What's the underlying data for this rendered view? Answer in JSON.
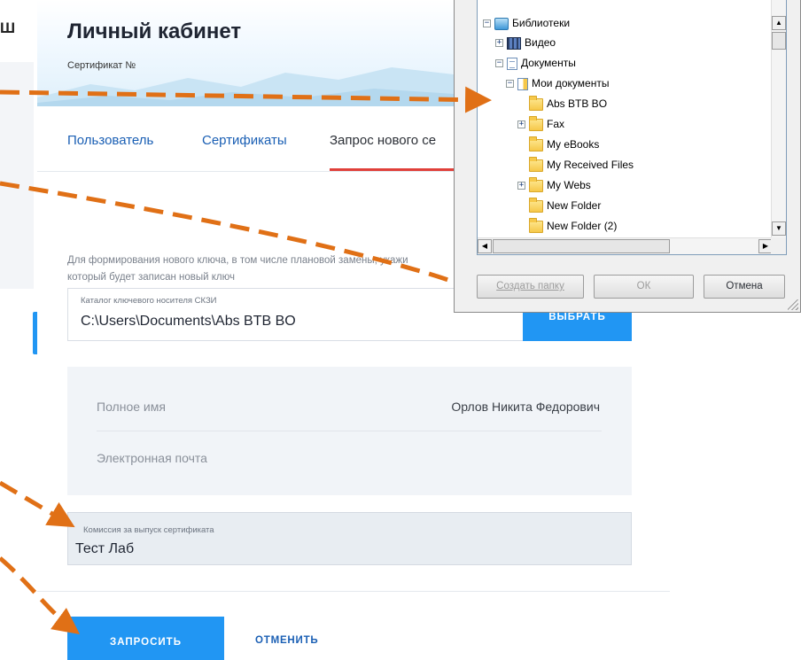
{
  "page": {
    "left_edge_letter": "Ш",
    "title": "Личный кабинет",
    "certificate_label": "Сертификат №"
  },
  "tabs": [
    {
      "label": "Пользователь",
      "active": false
    },
    {
      "label": "Сертификаты",
      "active": false
    },
    {
      "label": "Запрос нового се",
      "active": true
    }
  ],
  "key_form": {
    "description_line1": "Для формирования нового ключа, в том числе плановой замены, укажи",
    "description_line2": "который будет записан новый ключ",
    "field_caption": "Каталог ключевого носителя СКЗИ",
    "field_value": "C:\\Users\\Documents\\Abs BTB BO",
    "choose_button": "ВЫБРАТЬ"
  },
  "info": {
    "full_name_label": "Полное имя",
    "full_name_value": "Орлов Никита Федорович",
    "email_label": "Электронная почта",
    "email_value": ""
  },
  "commission": {
    "caption": "Комиссия за выпуск сертификата",
    "value": "Тест Лаб"
  },
  "actions": {
    "request_button": "ЗАПРОСИТЬ",
    "cancel_link": "ОТМЕНИТЬ"
  },
  "folder_dialog": {
    "tree": [
      {
        "label": "Библиотеки",
        "icon": "library-icon",
        "expander": "−"
      },
      {
        "label": "Видео",
        "icon": "video-icon",
        "expander": "+"
      },
      {
        "label": "Документы",
        "icon": "documents-icon",
        "expander": "−"
      },
      {
        "label": "Мои документы",
        "icon": "my-documents-icon",
        "expander": "−"
      },
      {
        "label": "Abs BTB BO",
        "icon": "folder-icon",
        "expander": ""
      },
      {
        "label": "Fax",
        "icon": "folder-icon",
        "expander": "+"
      },
      {
        "label": "My eBooks",
        "icon": "folder-icon",
        "expander": ""
      },
      {
        "label": "My Received Files",
        "icon": "folder-icon",
        "expander": ""
      },
      {
        "label": "My Webs",
        "icon": "folder-icon",
        "expander": "+"
      },
      {
        "label": "New Folder",
        "icon": "folder-icon",
        "expander": ""
      },
      {
        "label": "New Folder (2)",
        "icon": "folder-icon",
        "expander": ""
      }
    ],
    "create_folder_button": "Создать папку",
    "ok_button": "ОК",
    "cancel_button": "Отмена"
  },
  "colors": {
    "accent_blue": "#2196f3",
    "tab_underline": "#e0403a",
    "arrow_orange": "#e07016"
  }
}
